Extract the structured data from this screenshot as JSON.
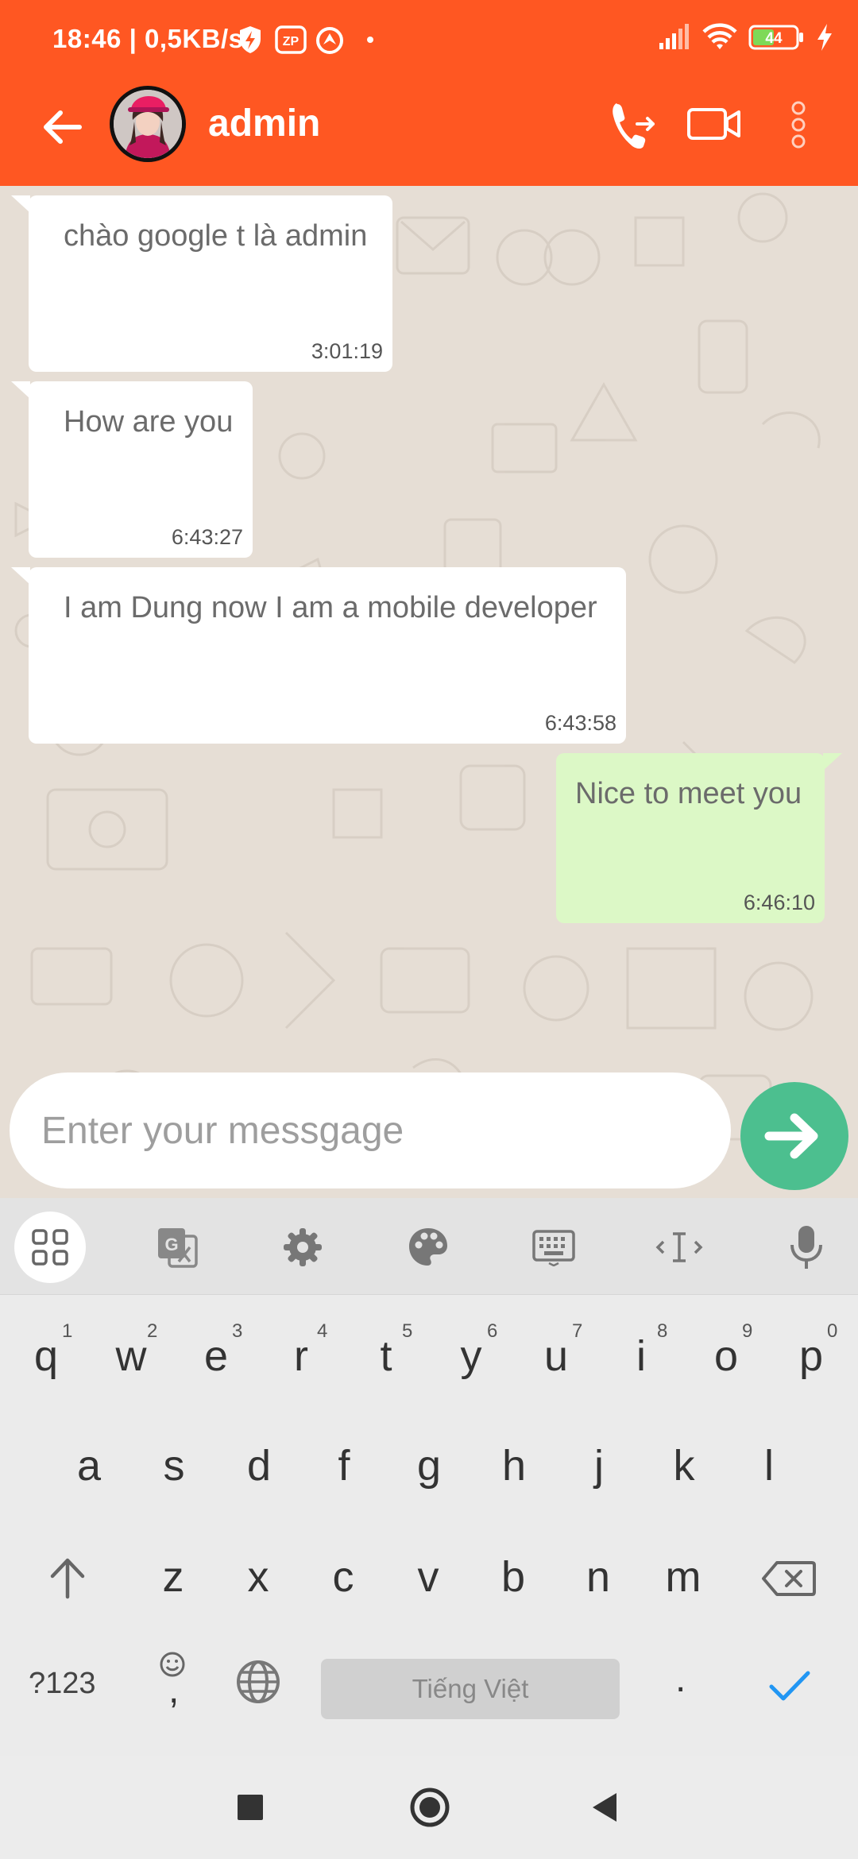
{
  "status_bar": {
    "time_speed": "18:46 | 0,5KB/s",
    "battery": "44"
  },
  "app_bar": {
    "contact_name": "admin"
  },
  "messages": [
    {
      "text": "chào google t là admin",
      "time": "3:01:19",
      "direction": "incoming"
    },
    {
      "text": "How are you",
      "time": "6:43:27",
      "direction": "incoming"
    },
    {
      "text": "I am Dung now I am a mobile developer",
      "time": "6:43:58",
      "direction": "incoming"
    },
    {
      "text": "Nice to meet you",
      "time": "6:46:10",
      "direction": "outgoing"
    }
  ],
  "composer": {
    "placeholder": "Enter your messgage",
    "value": ""
  },
  "keyboard": {
    "row1": [
      "q",
      "w",
      "e",
      "r",
      "t",
      "y",
      "u",
      "i",
      "o",
      "p"
    ],
    "row1_hints": [
      "1",
      "2",
      "3",
      "4",
      "5",
      "6",
      "7",
      "8",
      "9",
      "0"
    ],
    "row2": [
      "a",
      "s",
      "d",
      "f",
      "g",
      "h",
      "j",
      "k",
      "l"
    ],
    "row3": [
      "z",
      "x",
      "c",
      "v",
      "b",
      "n",
      "m"
    ],
    "symbols_label": "?123",
    "comma_label": ",",
    "period_label": ".",
    "space_label": "Tiếng Việt"
  },
  "colors": {
    "brand": "#ff5722",
    "send_button": "#4cbf8f",
    "incoming_bubble": "#ffffff",
    "outgoing_bubble": "#dcf8c6",
    "check_accent": "#2196f3"
  }
}
